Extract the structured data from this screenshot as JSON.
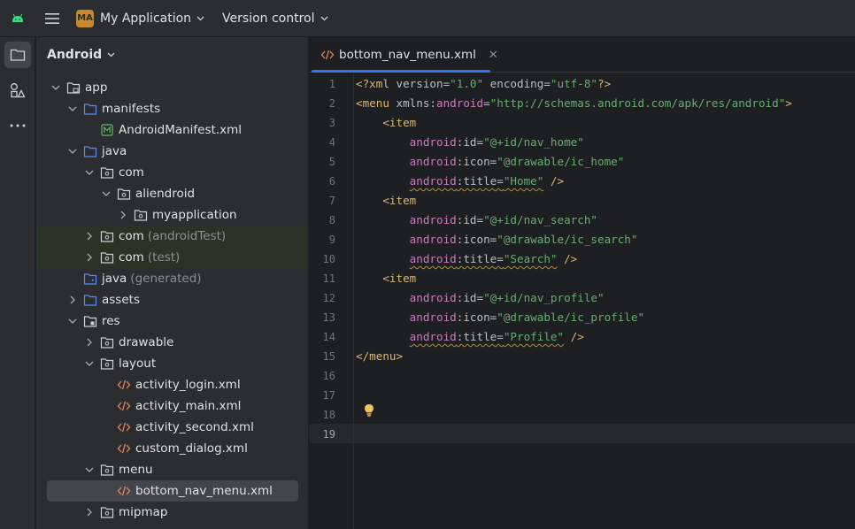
{
  "titlebar": {
    "project_badge": "MA",
    "project_name": "My Application",
    "vcs_label": "Version control"
  },
  "project_panel": {
    "view_label": "Android",
    "tree": [
      {
        "label": "app",
        "suffix": "",
        "depth": 0,
        "expanded": true,
        "icon": "module-folder-icon"
      },
      {
        "label": "manifests",
        "suffix": "",
        "depth": 1,
        "expanded": true,
        "icon": "folder-icon"
      },
      {
        "label": "AndroidManifest.xml",
        "suffix": "",
        "depth": 2,
        "expanded": null,
        "icon": "manifest-file-icon"
      },
      {
        "label": "java",
        "suffix": "",
        "depth": 1,
        "expanded": true,
        "icon": "folder-icon"
      },
      {
        "label": "com",
        "suffix": "",
        "depth": 2,
        "expanded": true,
        "icon": "package-icon"
      },
      {
        "label": "aliendroid",
        "suffix": "",
        "depth": 3,
        "expanded": true,
        "icon": "package-icon"
      },
      {
        "label": "myapplication",
        "suffix": "",
        "depth": 4,
        "expanded": false,
        "icon": "package-icon"
      },
      {
        "label": "com",
        "suffix": "(androidTest)",
        "depth": 2,
        "expanded": false,
        "icon": "package-icon",
        "test": true
      },
      {
        "label": "com",
        "suffix": "(test)",
        "depth": 2,
        "expanded": false,
        "icon": "package-icon",
        "test": true
      },
      {
        "label": "java",
        "suffix": "(generated)",
        "depth": 1,
        "expanded": null,
        "icon": "generated-folder-icon"
      },
      {
        "label": "assets",
        "suffix": "",
        "depth": 1,
        "expanded": false,
        "icon": "folder-icon"
      },
      {
        "label": "res",
        "suffix": "",
        "depth": 1,
        "expanded": true,
        "icon": "res-folder-icon"
      },
      {
        "label": "drawable",
        "suffix": "",
        "depth": 2,
        "expanded": false,
        "icon": "package-icon"
      },
      {
        "label": "layout",
        "suffix": "",
        "depth": 2,
        "expanded": true,
        "icon": "package-icon"
      },
      {
        "label": "activity_login.xml",
        "suffix": "",
        "depth": 3,
        "expanded": null,
        "icon": "xml-file-icon"
      },
      {
        "label": "activity_main.xml",
        "suffix": "",
        "depth": 3,
        "expanded": null,
        "icon": "xml-file-icon"
      },
      {
        "label": "activity_second.xml",
        "suffix": "",
        "depth": 3,
        "expanded": null,
        "icon": "xml-file-icon"
      },
      {
        "label": "custom_dialog.xml",
        "suffix": "",
        "depth": 3,
        "expanded": null,
        "icon": "xml-file-icon"
      },
      {
        "label": "menu",
        "suffix": "",
        "depth": 2,
        "expanded": true,
        "icon": "package-icon"
      },
      {
        "label": "bottom_nav_menu.xml",
        "suffix": "",
        "depth": 3,
        "expanded": null,
        "icon": "xml-file-icon",
        "selected": true
      },
      {
        "label": "mipmap",
        "suffix": "",
        "depth": 2,
        "expanded": false,
        "icon": "package-icon"
      }
    ]
  },
  "editor": {
    "tab_label": "bottom_nav_menu.xml",
    "current_line": 19,
    "lines": [
      [
        [
          "t-tag",
          "<?xml "
        ],
        [
          "t-attr",
          "version="
        ],
        [
          "t-str",
          "\"1.0\""
        ],
        [
          "t-attr",
          " encoding="
        ],
        [
          "t-str",
          "\"utf-8\""
        ],
        [
          "t-tag",
          "?>"
        ]
      ],
      [
        [
          "t-tag",
          "<menu "
        ],
        [
          "t-attr",
          "xmlns:"
        ],
        [
          "t-ns",
          "android"
        ],
        [
          "t-attr",
          "="
        ],
        [
          "t-str",
          "\"http://schemas.android.com/apk/res/android\""
        ],
        [
          "t-tag",
          ">"
        ]
      ],
      [
        [
          "t-pl",
          "    "
        ],
        [
          "t-tag",
          "<item"
        ]
      ],
      [
        [
          "t-pl",
          "        "
        ],
        [
          "t-ns",
          "android"
        ],
        [
          "t-attr",
          ":id="
        ],
        [
          "t-str",
          "\"@+id/nav_home\""
        ]
      ],
      [
        [
          "t-pl",
          "        "
        ],
        [
          "t-ns",
          "android"
        ],
        [
          "t-attr",
          ":icon="
        ],
        [
          "t-str",
          "\"@drawable/ic_home\""
        ]
      ],
      [
        [
          "t-pl",
          "        "
        ],
        [
          "t-ns wavy",
          "android"
        ],
        [
          "t-attr wavy",
          ":title="
        ],
        [
          "t-str wavy",
          "\"Home\""
        ],
        [
          "t-tag",
          " />"
        ]
      ],
      [
        [
          "t-pl",
          "    "
        ],
        [
          "t-tag",
          "<item"
        ]
      ],
      [
        [
          "t-pl",
          "        "
        ],
        [
          "t-ns",
          "android"
        ],
        [
          "t-attr",
          ":id="
        ],
        [
          "t-str",
          "\"@+id/nav_search\""
        ]
      ],
      [
        [
          "t-pl",
          "        "
        ],
        [
          "t-ns",
          "android"
        ],
        [
          "t-attr",
          ":icon="
        ],
        [
          "t-str",
          "\"@drawable/ic_search\""
        ]
      ],
      [
        [
          "t-pl",
          "        "
        ],
        [
          "t-ns wavy",
          "android"
        ],
        [
          "t-attr wavy",
          ":title="
        ],
        [
          "t-str wavy",
          "\"Search\""
        ],
        [
          "t-tag",
          " />"
        ]
      ],
      [
        [
          "t-pl",
          "    "
        ],
        [
          "t-tag",
          "<item"
        ]
      ],
      [
        [
          "t-pl",
          "        "
        ],
        [
          "t-ns",
          "android"
        ],
        [
          "t-attr",
          ":id="
        ],
        [
          "t-str",
          "\"@+id/nav_profile\""
        ]
      ],
      [
        [
          "t-pl",
          "        "
        ],
        [
          "t-ns",
          "android"
        ],
        [
          "t-attr",
          ":icon="
        ],
        [
          "t-str",
          "\"@drawable/ic_profile\""
        ]
      ],
      [
        [
          "t-pl",
          "        "
        ],
        [
          "t-ns wavy",
          "android"
        ],
        [
          "t-attr wavy",
          ":title="
        ],
        [
          "t-str wavy",
          "\"Profile\""
        ],
        [
          "t-tag",
          " />"
        ]
      ],
      [
        [
          "t-tag",
          "</menu>"
        ]
      ],
      [],
      [],
      [],
      []
    ]
  },
  "colors": {
    "accent": "#3574f0",
    "badge": "#c68a2a"
  }
}
